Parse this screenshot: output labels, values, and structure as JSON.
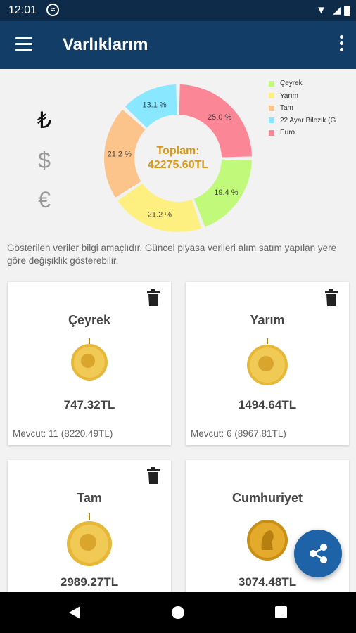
{
  "status_bar": {
    "time": "12:01"
  },
  "app_bar": {
    "title": "Varlıklarım"
  },
  "currencies": [
    "₺",
    "$",
    "€"
  ],
  "colors": {
    "app_bar": "#123d66",
    "fab": "#1e62a8",
    "total": "#d99a19"
  },
  "chart_data": {
    "type": "pie",
    "style": "donut",
    "categories": [
      "Euro",
      "Çeyrek",
      "Tam",
      "Yarım",
      "22 Ayar Bilezik (G"
    ],
    "values": [
      25.0,
      19.4,
      21.2,
      21.2,
      13.1
    ],
    "slice_labels": [
      "25.0 %",
      "19.4 %",
      "21.2 %",
      "21.2 %",
      "13.1 %"
    ],
    "colors": [
      "#fa8696",
      "#c1f97a",
      "#fef080",
      "#fcc48a",
      "#89e8ff"
    ],
    "center_label": "Toplam:",
    "center_value": "42275.60TL",
    "legend": [
      {
        "label": "Çeyrek",
        "color": "#c1f97a"
      },
      {
        "label": "Yarım",
        "color": "#fef080"
      },
      {
        "label": "Tam",
        "color": "#fcc48a"
      },
      {
        "label": "22 Ayar Bilezik (G",
        "color": "#89e8ff"
      },
      {
        "label": "Euro",
        "color": "#fa8696"
      }
    ],
    "legend_position": "right"
  },
  "note": "Gösterilen veriler bilgi amaçlıdır. Güncel piyasa verileri alım satım yapılan yere göre değişiklik gösterebilir.",
  "cards": [
    {
      "name": "Çeyrek",
      "price": "747.32TL",
      "stock": "Mevcut: 11 (8220.49TL)"
    },
    {
      "name": "Yarım",
      "price": "1494.64TL",
      "stock": "Mevcut: 6 (8967.81TL)"
    },
    {
      "name": "Tam",
      "price": "2989.27TL",
      "stock": ""
    },
    {
      "name": "Cumhuriyet",
      "price": "3074.48TL",
      "stock": ""
    }
  ]
}
